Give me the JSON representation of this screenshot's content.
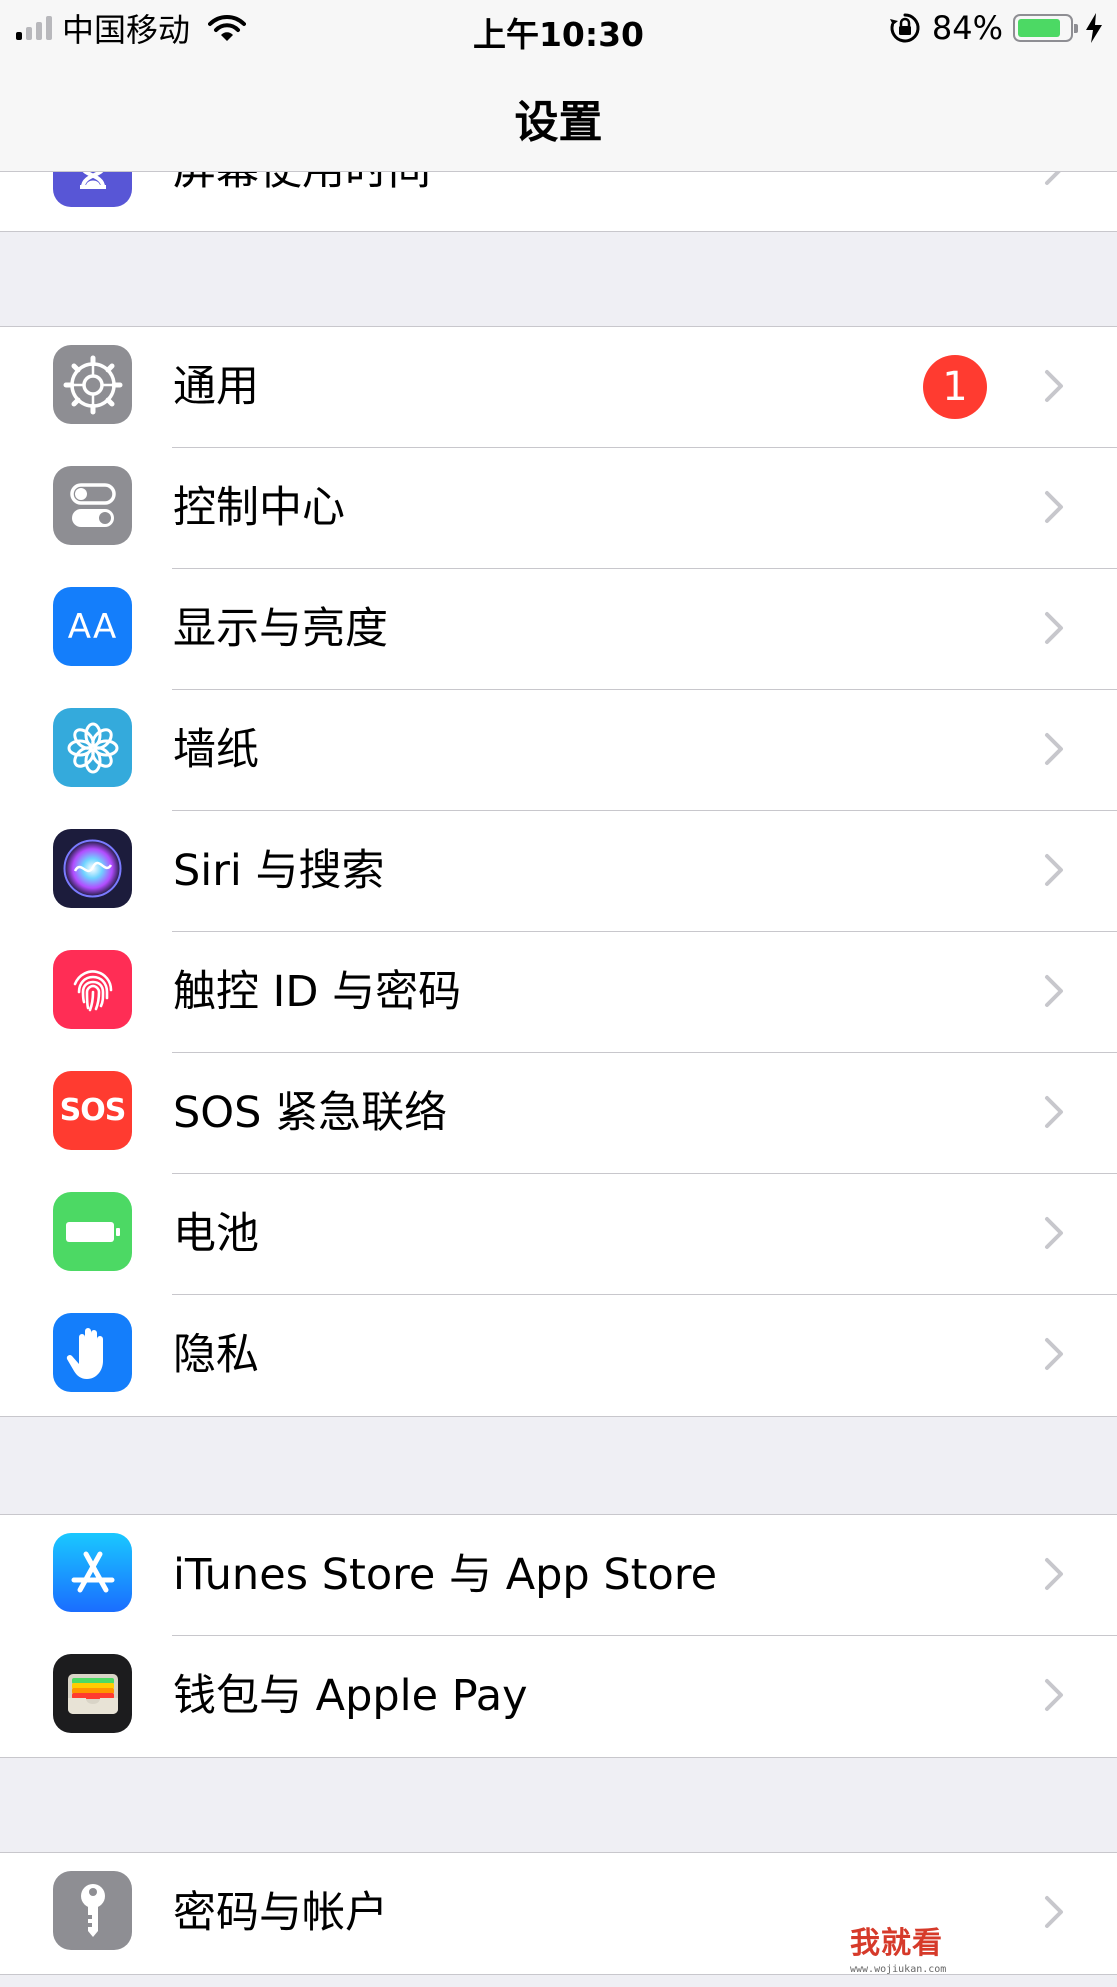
{
  "status_bar": {
    "carrier": "中国移动",
    "time": "上午10:30",
    "battery_percent": "84%",
    "battery_level": 0.84,
    "signal_bars_filled": 1
  },
  "nav": {
    "title": "设置"
  },
  "groups": [
    {
      "items": [
        {
          "label": "屏幕使用时间",
          "icon": "hourglass-icon",
          "color": "#5856d6"
        }
      ]
    },
    {
      "items": [
        {
          "label": "通用",
          "icon": "gear-icon",
          "color": "#8e8e93",
          "badge": "1"
        },
        {
          "label": "控制中心",
          "icon": "toggle-switches-icon",
          "color": "#8e8e93"
        },
        {
          "label": "显示与亮度",
          "icon": "text-size-icon",
          "color": "#147efb",
          "glyph": "AA"
        },
        {
          "label": "墙纸",
          "icon": "flower-icon",
          "color": "#34aadc"
        },
        {
          "label": "Siri 与搜索",
          "icon": "siri-icon",
          "color": "#1c1c3c"
        },
        {
          "label": "触控 ID 与密码",
          "icon": "fingerprint-icon",
          "color": "#ff2d55"
        },
        {
          "label": "SOS 紧急联络",
          "icon": "sos-icon",
          "color": "#ff3b30",
          "glyph": "SOS"
        },
        {
          "label": "电池",
          "icon": "battery-icon",
          "color": "#4cd964"
        },
        {
          "label": "隐私",
          "icon": "hand-icon",
          "color": "#147efb"
        }
      ]
    },
    {
      "items": [
        {
          "label": "iTunes Store 与 App Store",
          "icon": "app-store-icon",
          "color": "#1a8cff"
        },
        {
          "label": "钱包与 Apple Pay",
          "icon": "wallet-icon",
          "color": "#1c1c1e"
        }
      ]
    },
    {
      "items": [
        {
          "label": "密码与帐户",
          "icon": "key-icon",
          "color": "#8e8e93"
        }
      ]
    }
  ],
  "watermark": {
    "main": "我就看",
    "sub": "www.wojiukan.com"
  }
}
